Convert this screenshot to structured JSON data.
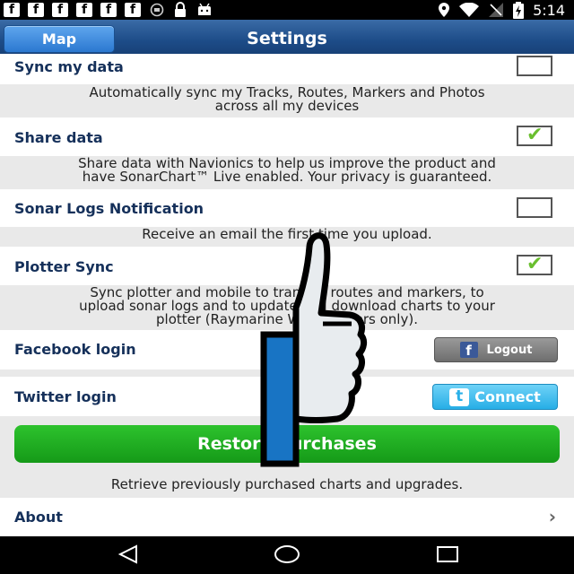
{
  "status_bar": {
    "time": "5:14",
    "notification_icons": [
      "facebook-icon",
      "facebook-icon",
      "facebook-icon",
      "facebook-icon",
      "facebook-icon",
      "facebook-icon",
      "sync-icon",
      "lock-icon",
      "android-icon"
    ],
    "notification_glyph": "f"
  },
  "header": {
    "back_label": "Map",
    "title": "Settings"
  },
  "settings": {
    "sync": {
      "label": "Sync my data",
      "checked": false,
      "desc_line1": "Automatically sync my Tracks, Routes, Markers and Photos",
      "desc_line2": "across all my devices"
    },
    "share": {
      "label": "Share data",
      "checked": true,
      "desc_line1": "Share data with Navionics to help us improve the product and",
      "desc_line2": "have SonarChart™ Live enabled. Your privacy is guaranteed."
    },
    "sonar": {
      "label": "Sonar Logs Notification",
      "checked": false,
      "desc_line1": "Receive an email the first time you upload."
    },
    "plotter": {
      "label": "Plotter Sync",
      "checked": true,
      "desc_line1": "Sync plotter and mobile to transfer routes and markers, to",
      "desc_line2": "upload sonar logs and to update and download charts to your",
      "desc_line3": "plotter (Raymarine Wi-Fi plotters only)."
    },
    "facebook": {
      "label": "Facebook login",
      "button_label": "Logout",
      "logo_glyph": "f"
    },
    "twitter": {
      "label": "Twitter login",
      "button_label": "Connect",
      "logo_glyph": "t"
    },
    "restore": {
      "button_label": "Restore Purchases",
      "desc": "Retrieve previously purchased charts and upgrades."
    },
    "about": {
      "label": "About",
      "chevron": "›"
    }
  },
  "colors": {
    "header_blue": "#1d4c88",
    "label_navy": "#15305a",
    "check_green": "#6abf2f",
    "restore_green": "#1aa51c",
    "twitter_blue": "#27aee6",
    "thumb_blue": "#1874c4"
  }
}
